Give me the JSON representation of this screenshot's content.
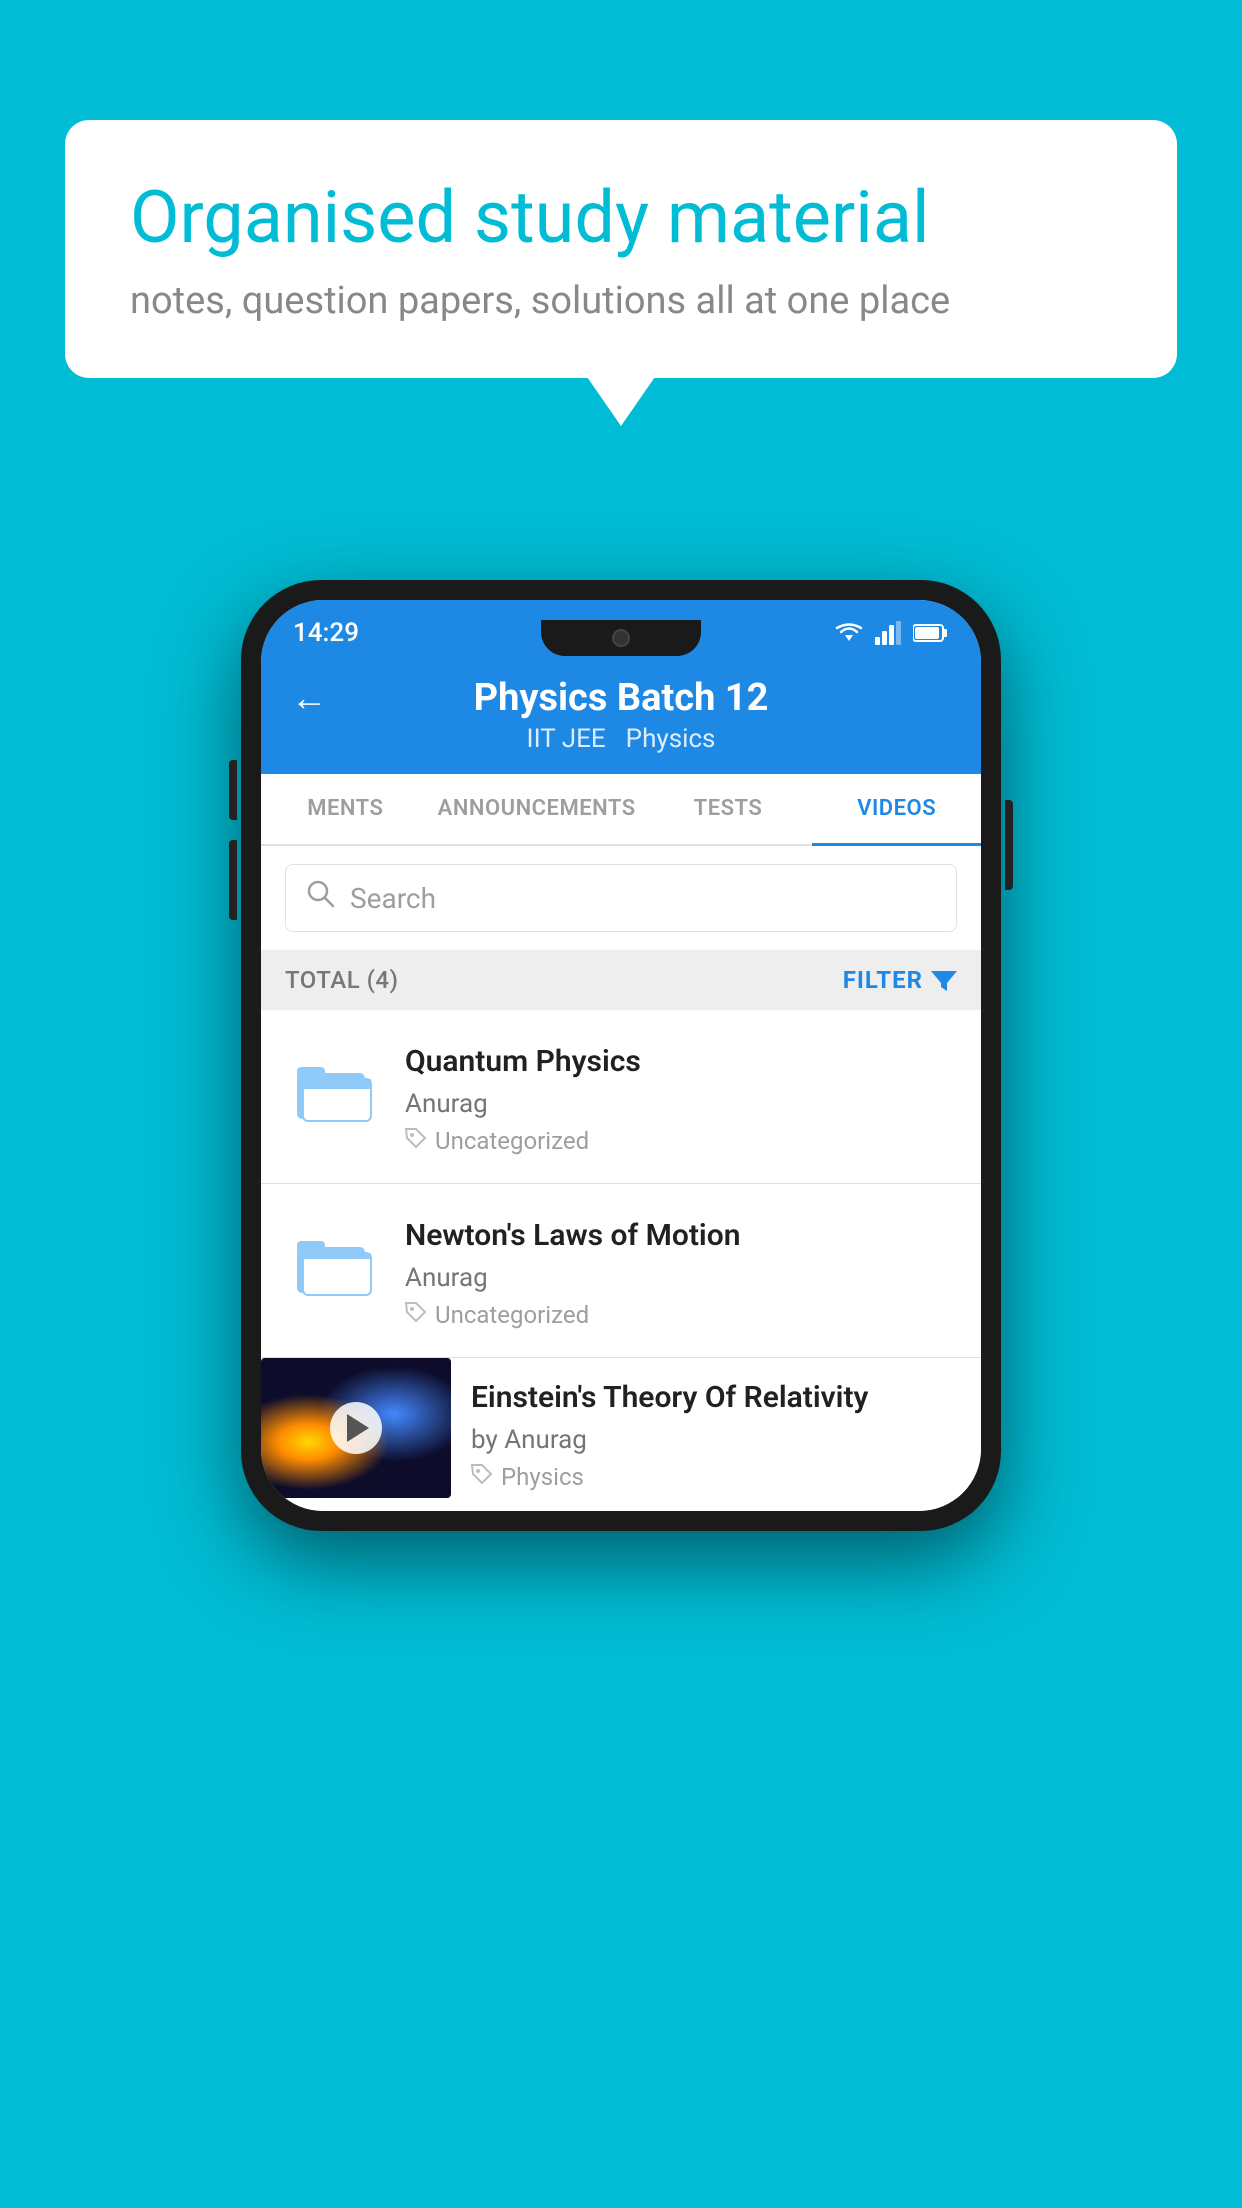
{
  "background_color": "#00bcd4",
  "speech_bubble": {
    "title": "Organised study material",
    "subtitle": "notes, question papers, solutions all at one place"
  },
  "status_bar": {
    "time": "14:29",
    "wifi": "▼",
    "signal": "◀",
    "battery": "▮"
  },
  "app_header": {
    "back_label": "←",
    "title": "Physics Batch 12",
    "subtitle_left": "IIT JEE",
    "subtitle_right": "Physics"
  },
  "tabs": [
    {
      "label": "MENTS",
      "active": false
    },
    {
      "label": "ANNOUNCEMENTS",
      "active": false
    },
    {
      "label": "TESTS",
      "active": false
    },
    {
      "label": "VIDEOS",
      "active": true
    }
  ],
  "search": {
    "placeholder": "Search"
  },
  "filter_bar": {
    "total_label": "TOTAL (4)",
    "filter_label": "FILTER"
  },
  "videos": [
    {
      "title": "Quantum Physics",
      "author": "Anurag",
      "tag": "Uncategorized",
      "type": "folder"
    },
    {
      "title": "Newton's Laws of Motion",
      "author": "Anurag",
      "tag": "Uncategorized",
      "type": "folder"
    },
    {
      "title": "Einstein's Theory Of Relativity",
      "author": "by Anurag",
      "tag": "Physics",
      "type": "video"
    }
  ]
}
